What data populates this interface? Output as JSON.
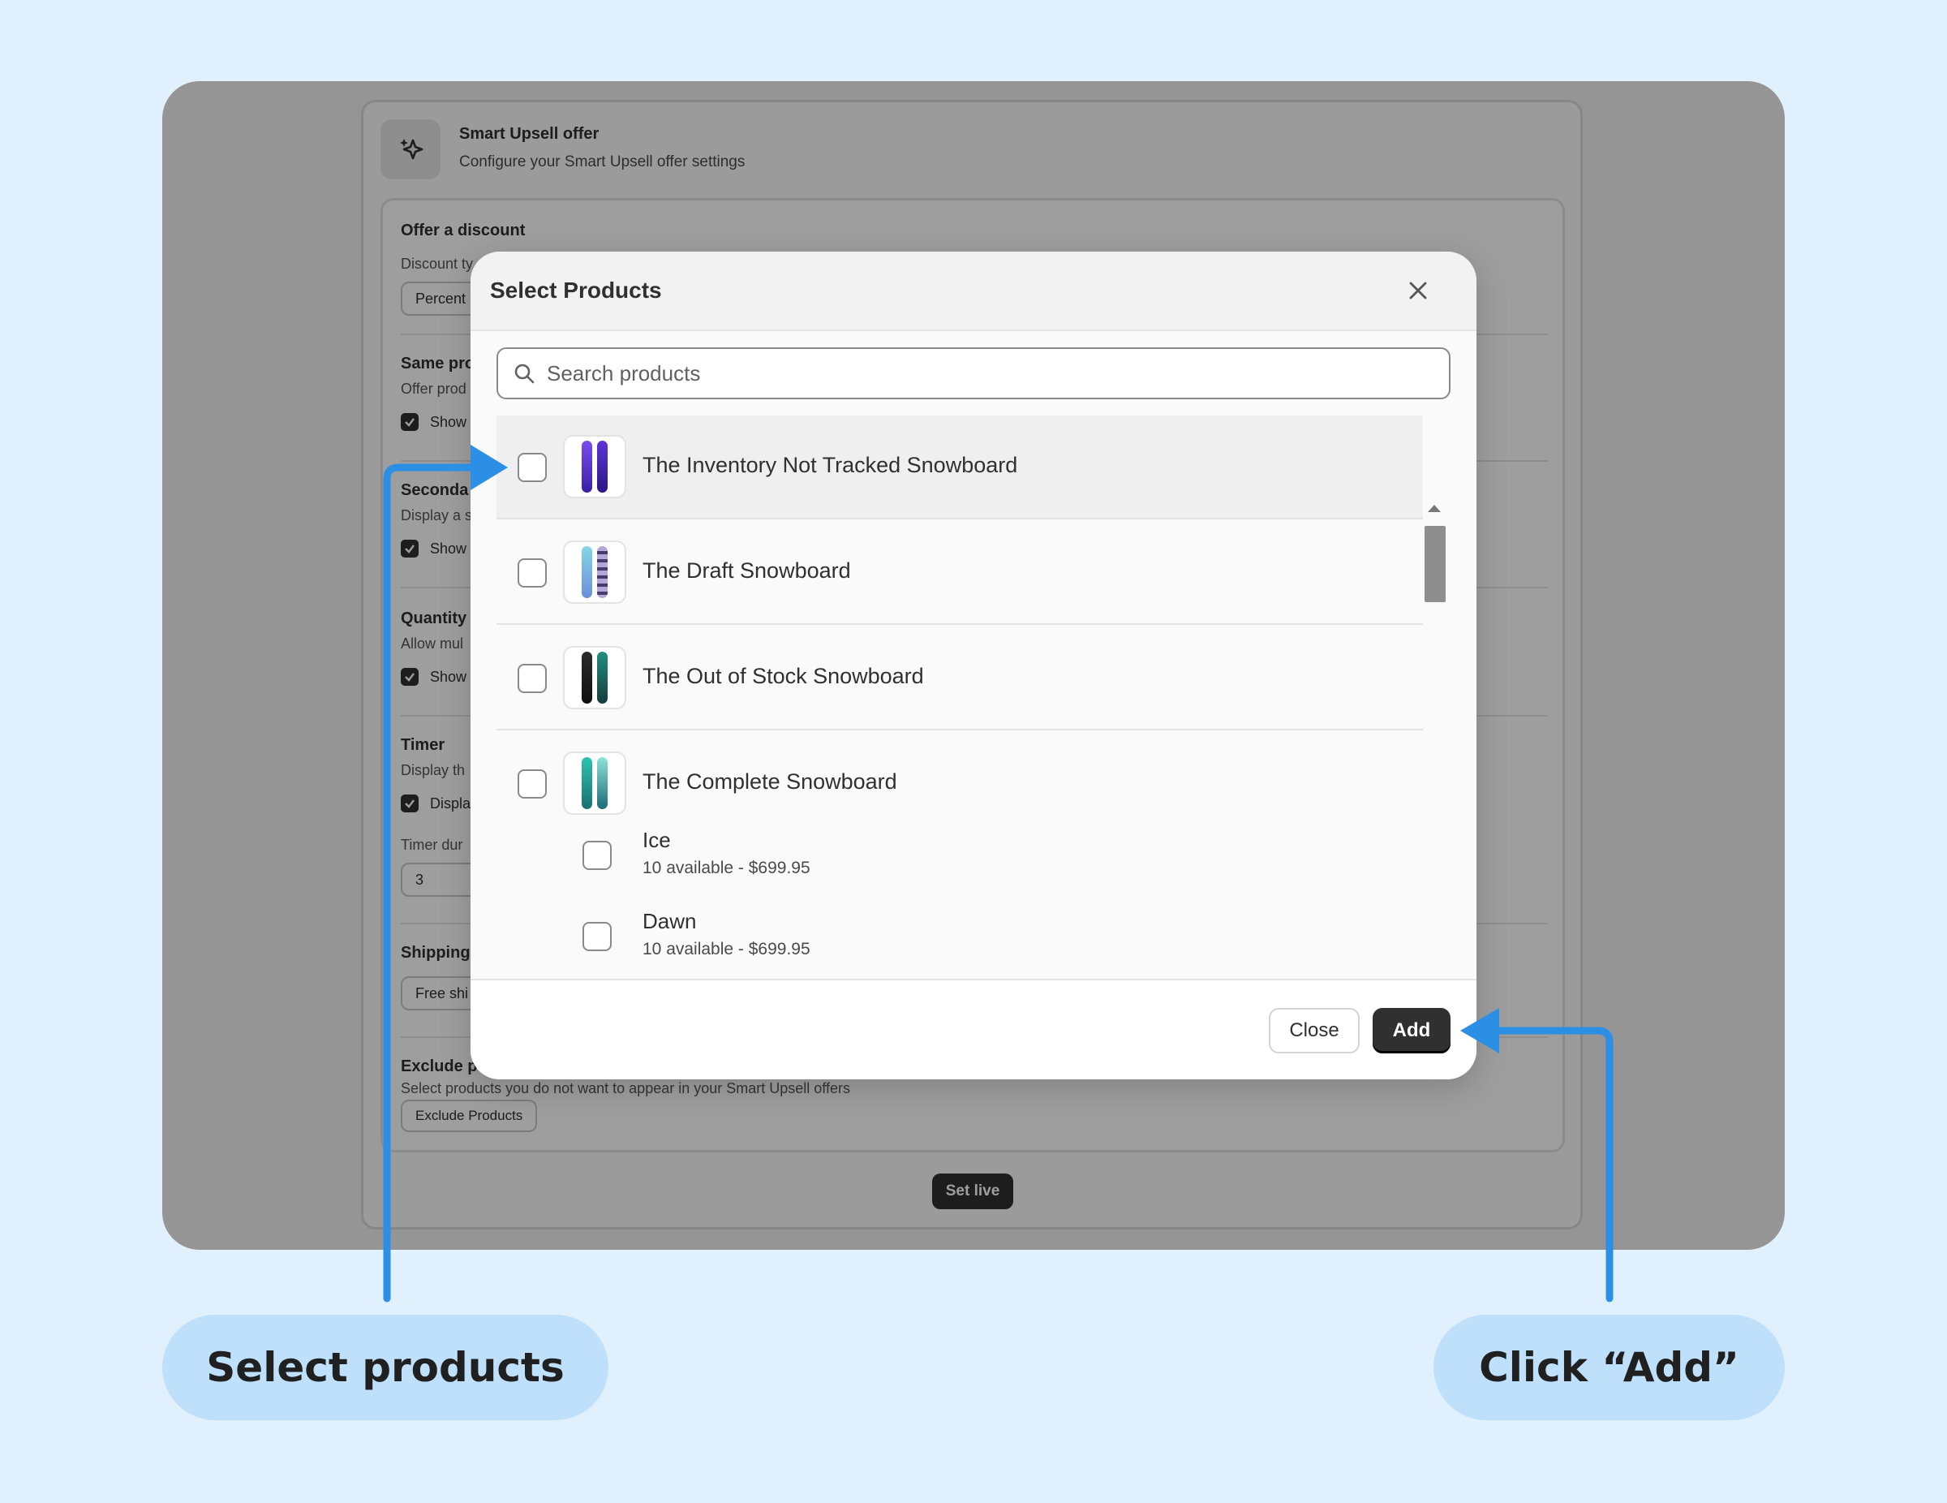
{
  "background_card": {
    "title": "Smart Upsell offer",
    "subtitle": "Configure your Smart Upsell offer settings",
    "sections": {
      "discount_title": "Offer a discount",
      "discount_type_label": "Discount ty",
      "discount_type_value": "Percent",
      "same_title": "Same pro",
      "same_desc": "Offer prod",
      "same_check": "Show",
      "secondary_title": "Seconda",
      "secondary_desc": "Display a s",
      "secondary_check": "Show",
      "quantity_title": "Quantity",
      "quantity_desc": "Allow mul",
      "quantity_check": "Show",
      "timer_title": "Timer",
      "timer_desc": "Display th",
      "timer_check": "Displa",
      "timer_duration_label": "Timer dur",
      "timer_duration_value": "3",
      "shipping_title": "Shipping",
      "shipping_value": "Free shi",
      "exclude_title": "Exclude p",
      "exclude_desc": "Select products you do not want to appear in your Smart Upsell offers",
      "exclude_button": "Exclude Products"
    },
    "set_live_label": "Set live"
  },
  "modal": {
    "title": "Select Products",
    "search_placeholder": "Search products",
    "products": [
      {
        "name": "The Inventory Not Tracked Snowboard"
      },
      {
        "name": "The Draft Snowboard"
      },
      {
        "name": "The Out of Stock Snowboard"
      },
      {
        "name": "The Complete Snowboard"
      }
    ],
    "variants": [
      {
        "name": "Ice",
        "detail": "10 available - $699.95"
      },
      {
        "name": "Dawn",
        "detail": "10 available - $699.95"
      }
    ],
    "close_label": "Close",
    "add_label": "Add"
  },
  "annotations": {
    "left_label": "Select products",
    "right_label": "Click “Add”",
    "arrow_color": "#2b8fe6"
  }
}
